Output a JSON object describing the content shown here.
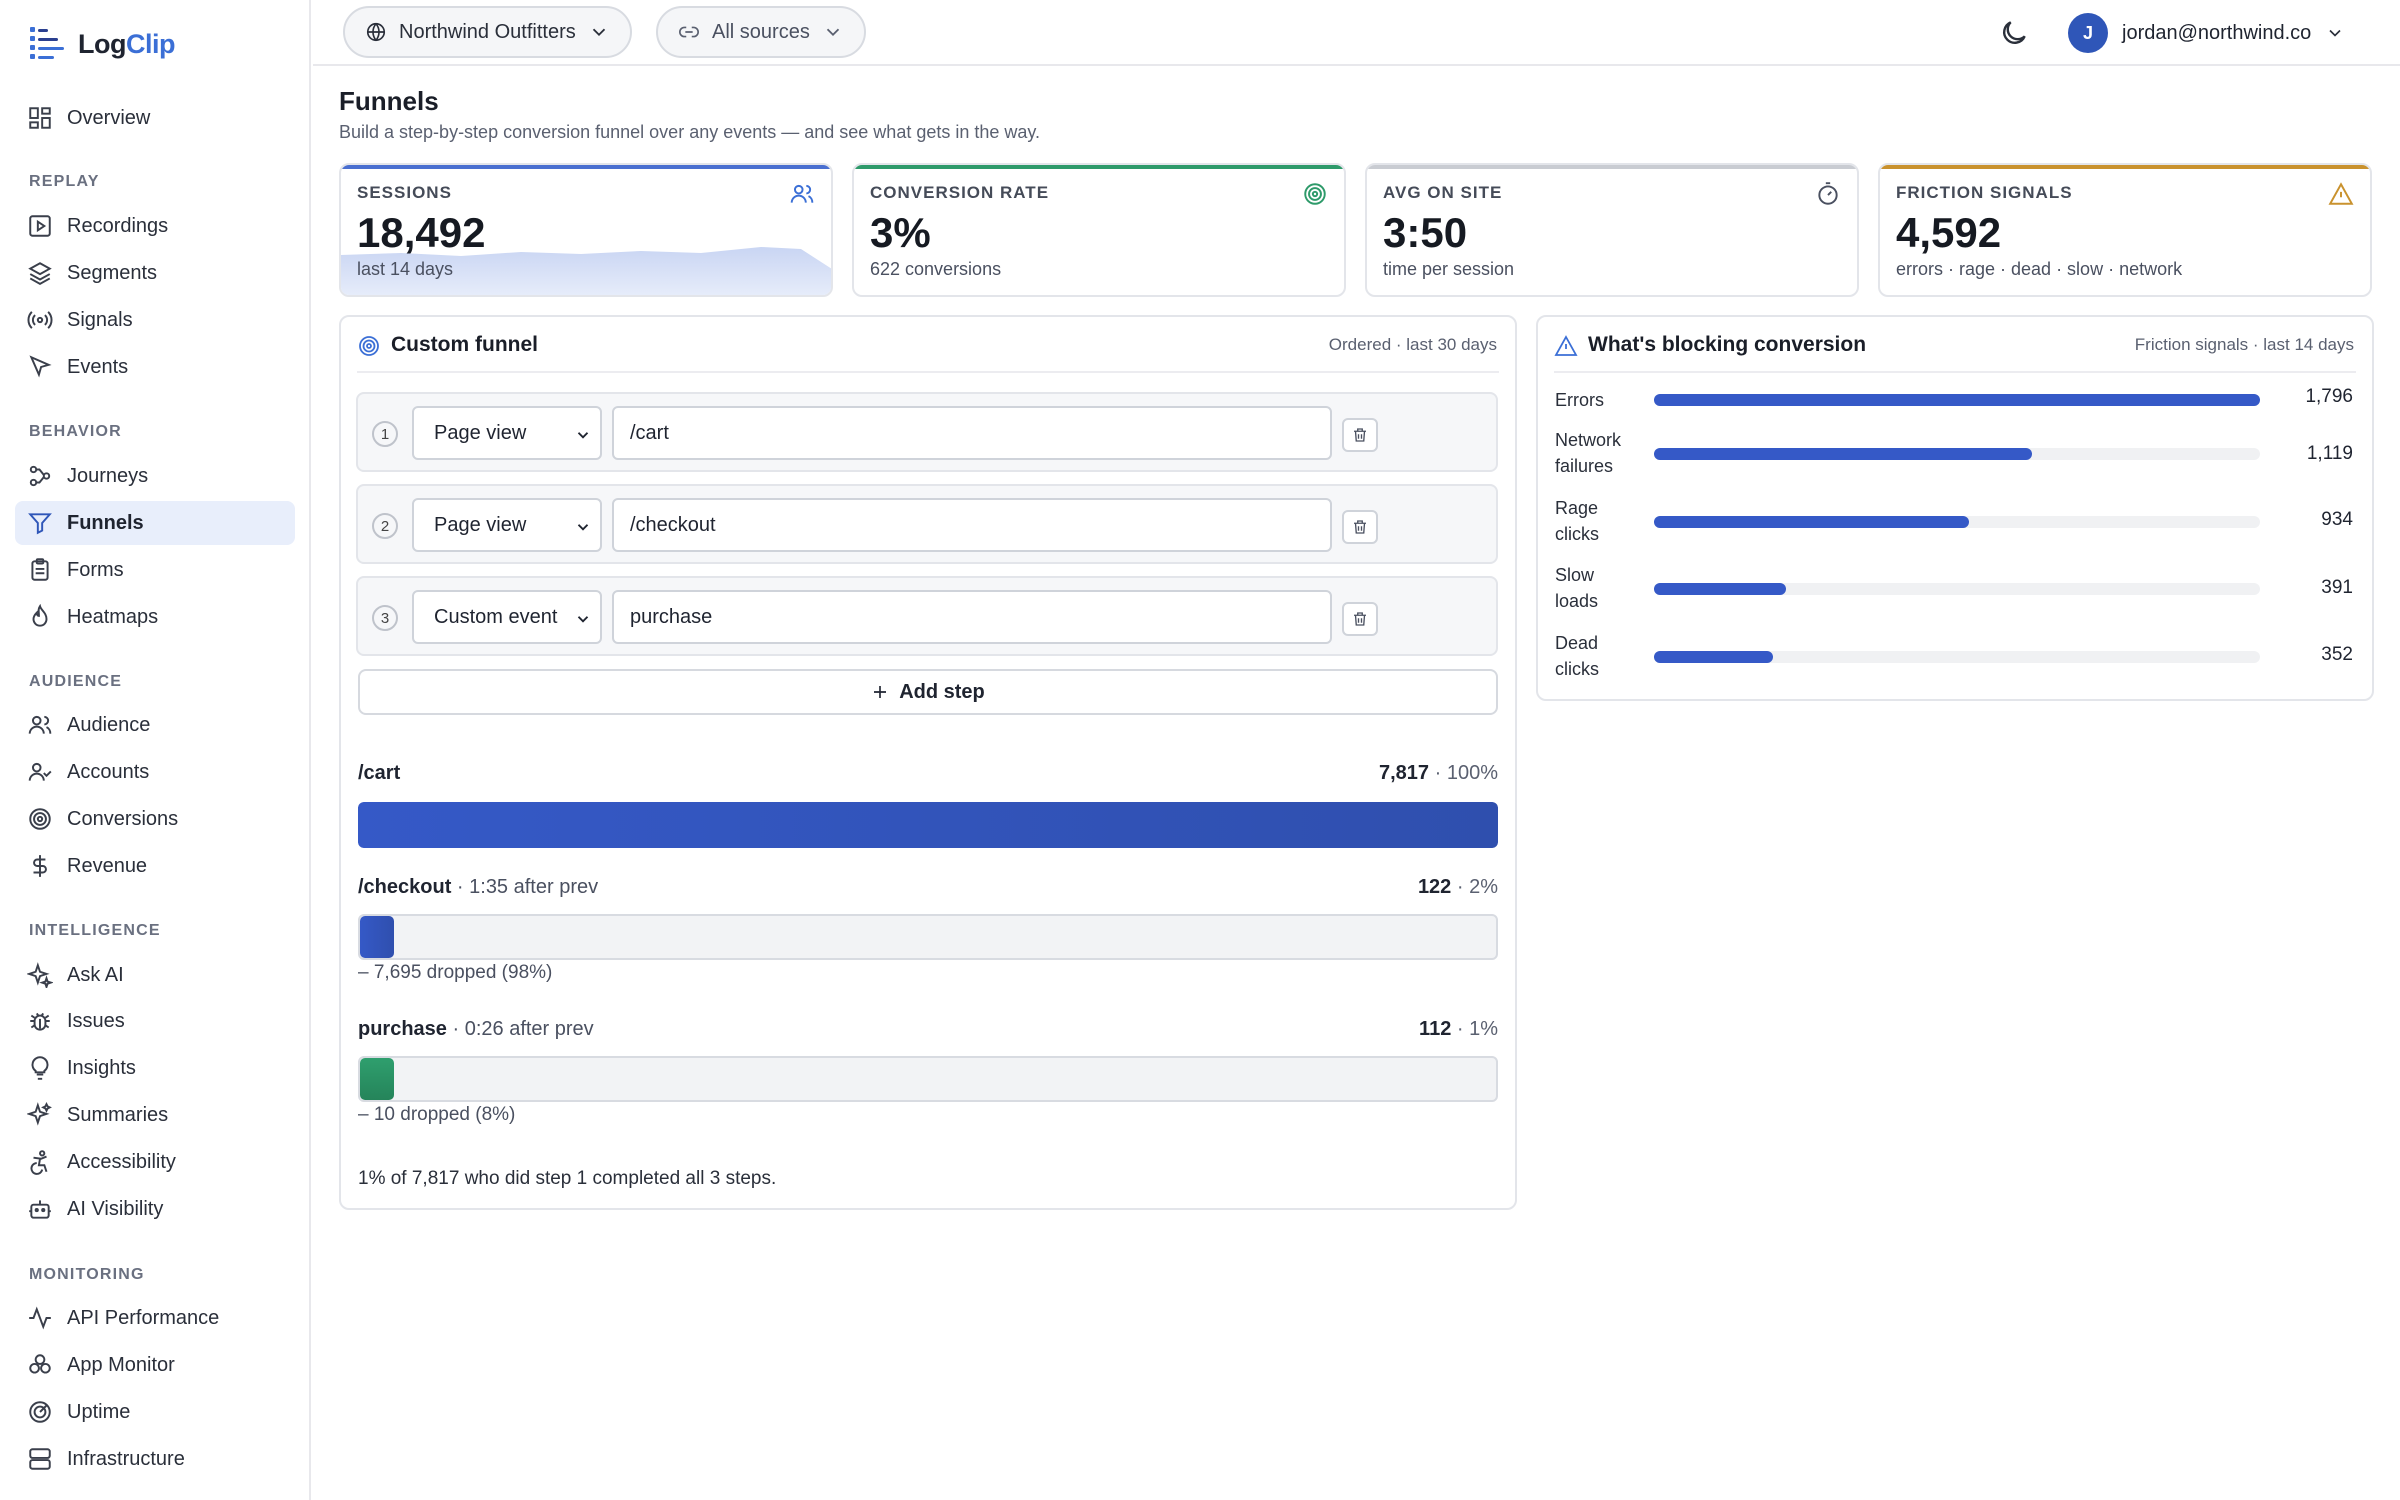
{
  "brand": {
    "name_part1": "Log",
    "name_part2": "Clip",
    "accent": "#3b6fd6"
  },
  "sidebar": {
    "overview": "Overview",
    "sections": {
      "replay": "REPLAY",
      "behavior": "BEHAVIOR",
      "audience": "AUDIENCE",
      "intelligence": "INTELLIGENCE",
      "monitoring": "MONITORING"
    },
    "replay": [
      "Recordings",
      "Segments",
      "Signals",
      "Events"
    ],
    "behavior": [
      "Journeys",
      "Funnels",
      "Forms",
      "Heatmaps"
    ],
    "audience": [
      "Audience",
      "Accounts",
      "Conversions",
      "Revenue"
    ],
    "intelligence": [
      "Ask AI",
      "Issues",
      "Insights",
      "Summaries",
      "Accessibility",
      "AI Visibility"
    ],
    "monitoring": [
      "API Performance",
      "App Monitor",
      "Uptime",
      "Infrastructure"
    ],
    "active": "Funnels"
  },
  "topbar": {
    "workspace": "Northwind Outfitters",
    "sources": "All sources",
    "user_initial": "J",
    "user_email": "jordan@northwind.co"
  },
  "page": {
    "title": "Funnels",
    "subtitle": "Build a step-by-step conversion funnel over any events — and see what gets in the way."
  },
  "kpis": [
    {
      "label": "SESSIONS",
      "value": "18,492",
      "sub": "last 14 days",
      "color": "#4a6fd0",
      "icon": "users-icon"
    },
    {
      "label": "CONVERSION RATE",
      "value": "3%",
      "sub": "622 conversions",
      "color": "#2e9a6a",
      "icon": "target-icon"
    },
    {
      "label": "AVG ON SITE",
      "value": "3:50",
      "sub": "time per session",
      "color": "#c9ccd2",
      "icon": "timer-icon"
    },
    {
      "label": "FRICTION SIGNALS",
      "value": "4,592",
      "sub": "errors · rage · dead · slow · network",
      "color": "#c9922e",
      "icon": "warning-icon"
    }
  ],
  "funnel_card": {
    "title": "Custom funnel",
    "meta": "Ordered · last 30 days",
    "steps": [
      {
        "num": "1",
        "type": "Page view",
        "value": "/cart"
      },
      {
        "num": "2",
        "type": "Page view",
        "value": "/checkout"
      },
      {
        "num": "3",
        "type": "Custom event",
        "value": "purchase"
      }
    ],
    "add_step": "Add step",
    "results": [
      {
        "name": "/cart",
        "after": "",
        "count": "7,817",
        "pct": "100%",
        "ratio": 1.0,
        "dropped": "",
        "color": "#3559c7"
      },
      {
        "name": "/checkout",
        "after": " · 1:35 after prev",
        "count": "122",
        "pct": "2%",
        "ratio": 0.03,
        "dropped": "– 7,695 dropped (98%)",
        "color": "#3559c7"
      },
      {
        "name": "purchase",
        "after": " · 0:26 after prev",
        "count": "112",
        "pct": "1%",
        "ratio": 0.03,
        "dropped": "– 10 dropped (8%)",
        "color": "#2e9a6a"
      }
    ],
    "summary": "1% of 7,817 who did step 1 completed all 3 steps."
  },
  "blocking_card": {
    "title": "What's blocking conversion",
    "meta": "Friction signals · last 14 days",
    "rows": [
      {
        "label_line1": "Errors",
        "label_line2": "",
        "value": "1,796",
        "ratio": 1.0
      },
      {
        "label_line1": "Network",
        "label_line2": "failures",
        "value": "1,119",
        "ratio": 0.623
      },
      {
        "label_line1": "Rage",
        "label_line2": "clicks",
        "value": "934",
        "ratio": 0.52
      },
      {
        "label_line1": "Slow",
        "label_line2": "loads",
        "value": "391",
        "ratio": 0.218
      },
      {
        "label_line1": "Dead",
        "label_line2": "clicks",
        "value": "352",
        "ratio": 0.196
      }
    ]
  }
}
